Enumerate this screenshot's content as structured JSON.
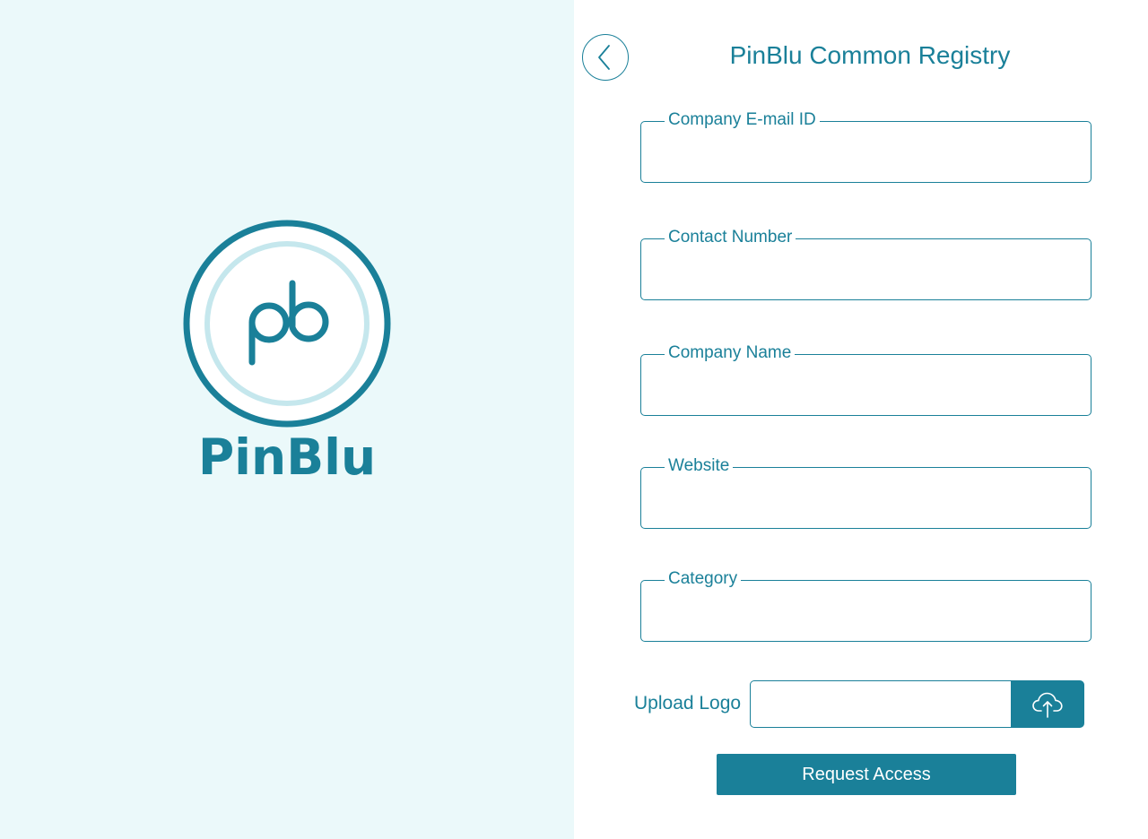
{
  "brand": {
    "name": "PinBlu",
    "monogram": "pb",
    "logo_icon": "pinblu-logo-icon"
  },
  "header": {
    "title": "PinBlu Common Registry",
    "back_icon": "chevron-left-icon"
  },
  "form": {
    "fields": [
      {
        "label": "Company E-mail ID",
        "value": "",
        "placeholder": ""
      },
      {
        "label": "Contact Number",
        "value": "",
        "placeholder": ""
      },
      {
        "label": "Company Name",
        "value": "",
        "placeholder": ""
      },
      {
        "label": "Website",
        "value": "",
        "placeholder": ""
      },
      {
        "label": "Category",
        "value": "",
        "placeholder": ""
      }
    ],
    "upload": {
      "label": "Upload Logo",
      "value": "",
      "icon": "cloud-upload-icon"
    },
    "submit_label": "Request Access"
  },
  "colors": {
    "primary": "#1a8099",
    "left_background": "#ebf9fa",
    "logo_inner_ring": "#c5e7ed",
    "surface": "#ffffff"
  }
}
